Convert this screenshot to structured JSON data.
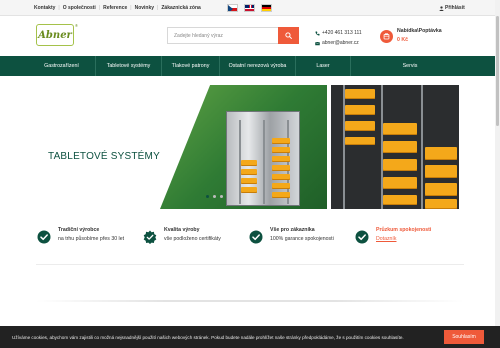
{
  "topbar": {
    "links": [
      "Kontakty",
      "O společnosti",
      "Reference",
      "Novinky",
      "Zákaznická zóna"
    ],
    "flags": [
      "flag-cz",
      "flag-gb",
      "flag-de"
    ],
    "login_label": "Přihlásit"
  },
  "header": {
    "logo_text": "Abner",
    "logo_mark": "®",
    "search_placeholder": "Zadejte hledaný výraz",
    "phone": "+420 461 313 111",
    "email": "abner@abner.cz",
    "cart_title": "Nabídka\\Poptávka",
    "cart_price": "0 Kč"
  },
  "nav": {
    "items": [
      "Gastrozařízení",
      "Tabletové systémy",
      "Tlakové patrony",
      "Ostatní nerezová výroba",
      "Laser",
      "Servis"
    ]
  },
  "hero": {
    "title": "TABLETOVÉ SYSTÉMY",
    "dots": 3,
    "active_dot": 0
  },
  "benefits": [
    {
      "icon": "check-circle-icon",
      "title": "Tradiční výrobce",
      "desc": "na trhu působíme přes 30 let",
      "accent": false
    },
    {
      "icon": "badge-check-icon",
      "title": "Kvalita výroby",
      "desc": "vše podloženo certifikáty",
      "accent": false
    },
    {
      "icon": "check-circle-icon",
      "title": "Vše pro zákazníka",
      "desc": "100% garance spokojenosti",
      "accent": false
    },
    {
      "icon": "check-circle-icon",
      "title": "Průzkum spokojenosti",
      "desc": "Dotazník",
      "accent": true
    }
  ],
  "cookie": {
    "text": "Užíváme cookies, abychom vám zajistili co možná nejsnadnější použití našich webových stránek. Pokud budete nadále prohlížet naše stránky předpokládáme, že s použitím cookies souhlasíte.",
    "button": "Souhlasím"
  },
  "colors": {
    "brand_green": "#0d5140",
    "accent_orange": "#ef5a3a",
    "logo_green": "#a5c24a"
  }
}
